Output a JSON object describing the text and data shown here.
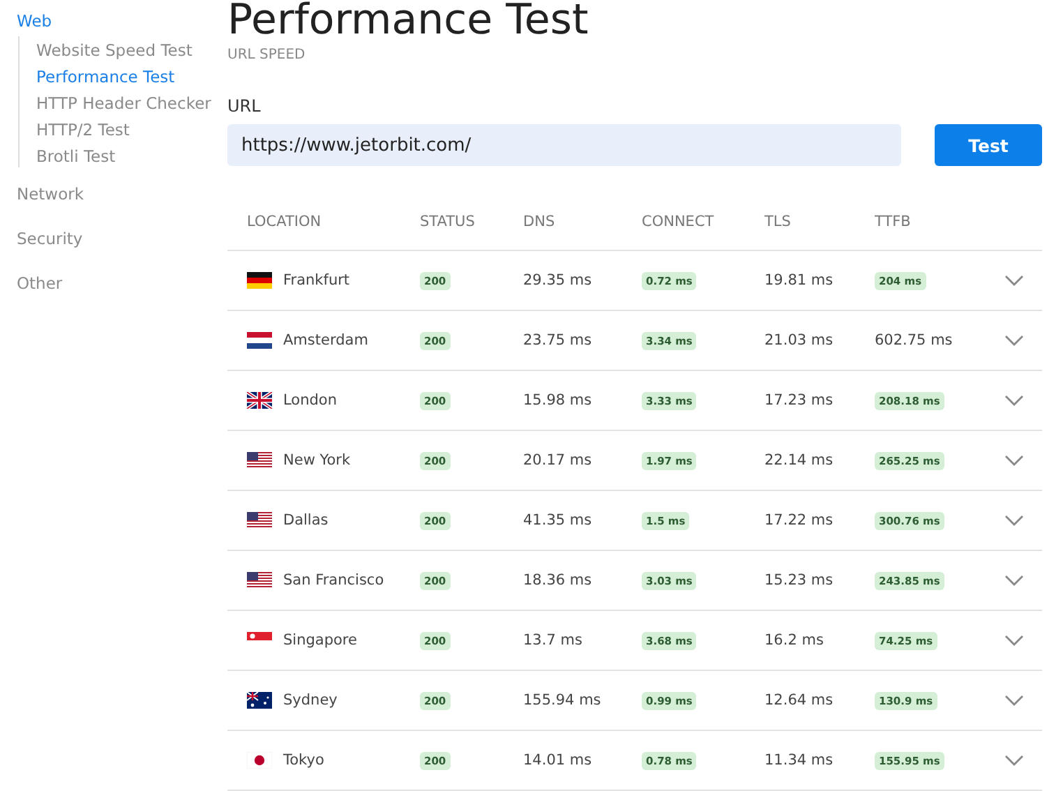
{
  "sidebar": {
    "sections": [
      {
        "label": "Web",
        "selected": true,
        "children": [
          {
            "label": "Website Speed Test",
            "selected": false
          },
          {
            "label": "Performance Test",
            "selected": true
          },
          {
            "label": "HTTP Header Checker",
            "selected": false
          },
          {
            "label": "HTTP/2 Test",
            "selected": false
          },
          {
            "label": "Brotli Test",
            "selected": false
          }
        ]
      },
      {
        "label": "Network",
        "selected": false
      },
      {
        "label": "Security",
        "selected": false
      },
      {
        "label": "Other",
        "selected": false
      }
    ]
  },
  "page": {
    "title": "Performance Test",
    "subtitle": "URL SPEED"
  },
  "form": {
    "label": "URL",
    "value": "https://www.jetorbit.com/",
    "button": "Test"
  },
  "table": {
    "columns": [
      "LOCATION",
      "STATUS",
      "DNS",
      "CONNECT",
      "TLS",
      "TTFB"
    ],
    "rows": [
      {
        "kind": "de",
        "location": "Frankfurt",
        "status": "200",
        "dns": "29.35 ms",
        "connect": {
          "text": "0.72 ms",
          "badge": true
        },
        "tls": "19.81 ms",
        "ttfb": {
          "text": "204 ms",
          "badge": true
        },
        "expanded": false
      },
      {
        "kind": "nl",
        "location": "Amsterdam",
        "status": "200",
        "dns": "23.75 ms",
        "connect": {
          "text": "3.34 ms",
          "badge": true
        },
        "tls": "21.03 ms",
        "ttfb": {
          "text": "602.75 ms",
          "badge": false
        },
        "expanded": false
      },
      {
        "kind": "gb",
        "location": "London",
        "status": "200",
        "dns": "15.98 ms",
        "connect": {
          "text": "3.33 ms",
          "badge": true
        },
        "tls": "17.23 ms",
        "ttfb": {
          "text": "208.18 ms",
          "badge": true
        },
        "expanded": false
      },
      {
        "kind": "us",
        "location": "New York",
        "status": "200",
        "dns": "20.17 ms",
        "connect": {
          "text": "1.97 ms",
          "badge": true
        },
        "tls": "22.14 ms",
        "ttfb": {
          "text": "265.25 ms",
          "badge": true
        },
        "expanded": false
      },
      {
        "kind": "us",
        "location": "Dallas",
        "status": "200",
        "dns": "41.35 ms",
        "connect": {
          "text": "1.5 ms",
          "badge": true
        },
        "tls": "17.22 ms",
        "ttfb": {
          "text": "300.76 ms",
          "badge": true
        },
        "expanded": false
      },
      {
        "kind": "us",
        "location": "San Francisco",
        "status": "200",
        "dns": "18.36 ms",
        "connect": {
          "text": "3.03 ms",
          "badge": true
        },
        "tls": "15.23 ms",
        "ttfb": {
          "text": "243.85 ms",
          "badge": true
        },
        "expanded": false
      },
      {
        "kind": "sg",
        "location": "Singapore",
        "status": "200",
        "dns": "13.7 ms",
        "connect": {
          "text": "3.68 ms",
          "badge": true
        },
        "tls": "16.2 ms",
        "ttfb": {
          "text": "74.25 ms",
          "badge": true
        },
        "expanded": false
      },
      {
        "kind": "au",
        "location": "Sydney",
        "status": "200",
        "dns": "155.94 ms",
        "connect": {
          "text": "0.99 ms",
          "badge": true
        },
        "tls": "12.64 ms",
        "ttfb": {
          "text": "130.9 ms",
          "badge": true
        },
        "expanded": false
      },
      {
        "kind": "jp",
        "location": "Tokyo",
        "status": "200",
        "dns": "14.01 ms",
        "connect": {
          "text": "0.78 ms",
          "badge": true
        },
        "tls": "11.34 ms",
        "ttfb": {
          "text": "155.95 ms",
          "badge": true
        },
        "expanded": false
      }
    ]
  }
}
